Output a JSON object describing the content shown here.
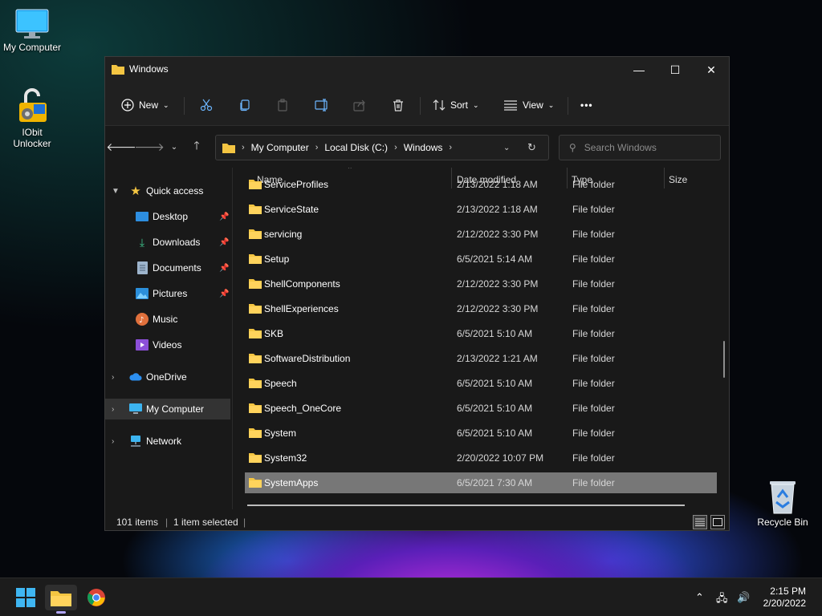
{
  "desktop": {
    "icons": [
      {
        "label": "My Computer"
      },
      {
        "label": "IObit Unlocker"
      },
      {
        "label": "Recycle Bin"
      }
    ]
  },
  "window": {
    "title": "Windows",
    "controls": {
      "minimize": "—",
      "maximize": "☐",
      "close": "✕"
    },
    "toolbar": {
      "new_label": "New",
      "sort_label": "Sort",
      "view_label": "View",
      "more_label": "•••"
    },
    "address": {
      "crumbs": [
        "My Computer",
        "Local Disk (C:)",
        "Windows"
      ]
    },
    "search": {
      "placeholder": "Search Windows"
    },
    "sidebar": {
      "quick_access": "Quick access",
      "items": [
        {
          "label": "Desktop",
          "pinned": true
        },
        {
          "label": "Downloads",
          "pinned": true
        },
        {
          "label": "Documents",
          "pinned": true
        },
        {
          "label": "Pictures",
          "pinned": true
        },
        {
          "label": "Music",
          "pinned": false
        },
        {
          "label": "Videos",
          "pinned": false
        }
      ],
      "onedrive": "OneDrive",
      "my_computer": "My Computer",
      "network": "Network"
    },
    "columns": {
      "name": "Name",
      "date": "Date modified",
      "type": "Type",
      "size": "Size"
    },
    "files": [
      {
        "name": "ServiceProfiles",
        "date": "2/13/2022 1:18 AM",
        "type": "File folder"
      },
      {
        "name": "ServiceState",
        "date": "2/13/2022 1:18 AM",
        "type": "File folder"
      },
      {
        "name": "servicing",
        "date": "2/12/2022 3:30 PM",
        "type": "File folder"
      },
      {
        "name": "Setup",
        "date": "6/5/2021 5:14 AM",
        "type": "File folder"
      },
      {
        "name": "ShellComponents",
        "date": "2/12/2022 3:30 PM",
        "type": "File folder"
      },
      {
        "name": "ShellExperiences",
        "date": "2/12/2022 3:30 PM",
        "type": "File folder"
      },
      {
        "name": "SKB",
        "date": "6/5/2021 5:10 AM",
        "type": "File folder"
      },
      {
        "name": "SoftwareDistribution",
        "date": "2/13/2022 1:21 AM",
        "type": "File folder"
      },
      {
        "name": "Speech",
        "date": "6/5/2021 5:10 AM",
        "type": "File folder"
      },
      {
        "name": "Speech_OneCore",
        "date": "6/5/2021 5:10 AM",
        "type": "File folder"
      },
      {
        "name": "System",
        "date": "6/5/2021 5:10 AM",
        "type": "File folder"
      },
      {
        "name": "System32",
        "date": "2/20/2022 10:07 PM",
        "type": "File folder"
      },
      {
        "name": "SystemApps",
        "date": "6/5/2021 7:30 AM",
        "type": "File folder",
        "selected": true
      }
    ],
    "status": {
      "items": "101 items",
      "selected": "1 item selected"
    }
  },
  "taskbar": {
    "clock_time": "2:15 PM",
    "clock_date": "2/20/2022"
  },
  "colors": {
    "accent": "#0078d4",
    "folder": "#f4c542",
    "selection": "#777777"
  }
}
